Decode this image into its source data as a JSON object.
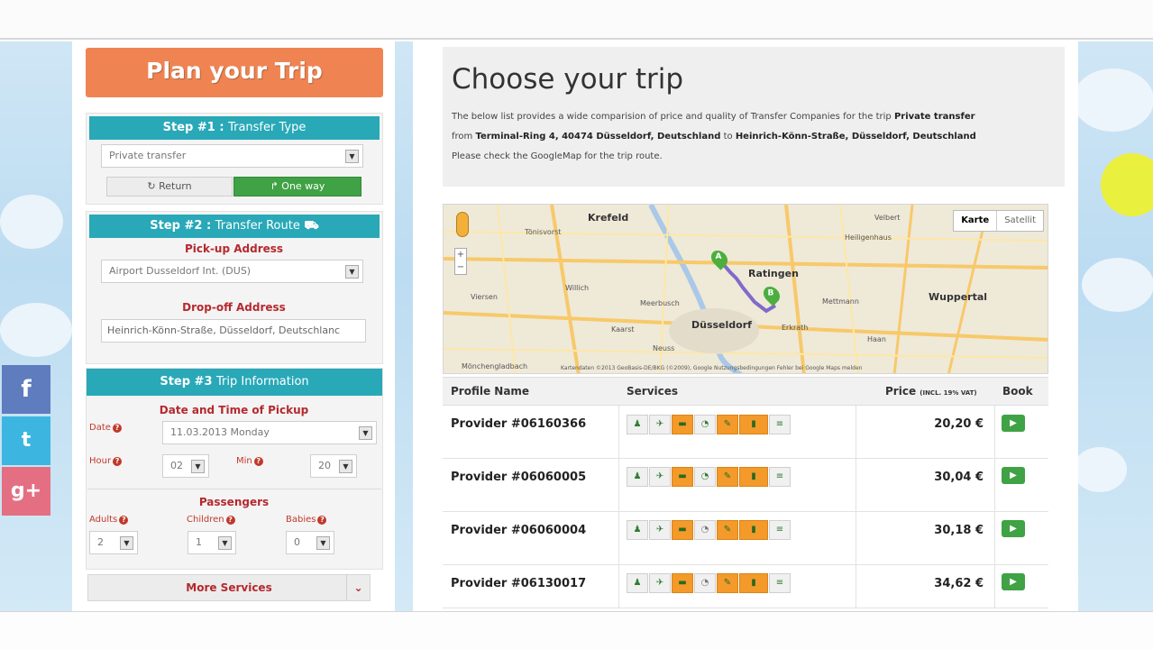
{
  "left": {
    "plan_title": "Plan your Trip",
    "step1": {
      "num": "Step #1 :",
      "title": "Transfer Type",
      "select_value": "Private transfer",
      "return_label": "Return",
      "oneway_label": "One way"
    },
    "step2": {
      "num": "Step #2 :",
      "title": "Transfer Route",
      "pickup_label": "Pick-up Address",
      "pickup_value": "Airport Dusseldorf Int. (DUS)",
      "dropoff_label": "Drop-off Address",
      "dropoff_value": "Heinrich-Könn-Straße, Düsseldorf, Deutschlanc"
    },
    "step3": {
      "num": "Step #3",
      "title": "Trip Information",
      "datetime_label": "Date and Time of Pickup",
      "date_label": "Date",
      "date_value": "11.03.2013 Monday",
      "hour_label": "Hour",
      "hour_value": "02",
      "min_label": "Min",
      "min_value": "20",
      "passengers_label": "Passengers",
      "adults_label": "Adults",
      "adults_value": "2",
      "children_label": "Children",
      "children_value": "1",
      "babies_label": "Babies",
      "babies_value": "0"
    },
    "more_services": "More Services"
  },
  "social": {
    "facebook": "f",
    "twitter": "t",
    "googleplus": "g+"
  },
  "main": {
    "heading": "Choose your trip",
    "desc_1": "The below list provides a wide comparision of price and quality of Transfer Companies for the trip",
    "desc_trip": "Private transfer",
    "desc_from": "from",
    "desc_from_addr": "Terminal-Ring 4, 40474 Düsseldorf, Deutschland",
    "desc_to": "to",
    "desc_to_addr": "Heinrich-Könn-Straße, Düsseldorf, Deutschland",
    "desc_2": "Please check the GoogleMap for the trip route."
  },
  "map": {
    "type_map": "Karte",
    "type_sat": "Satellit",
    "credit": "Kartendaten ©2013 GeoBasis-DE/BKG (©2009), Google",
    "terms": "Nutzungsbedingungen",
    "report": "Fehler bei Google Maps melden",
    "cities": {
      "krefeld": "Krefeld",
      "ratingen": "Ratingen",
      "wuppertal": "Wuppertal",
      "dusseldorf": "Düsseldorf",
      "viersen": "Viersen",
      "meerbusch": "Meerbusch",
      "neuss": "Neuss",
      "velbert": "Velbert",
      "tonisvorst": "Tönisvorst",
      "willich": "Willich",
      "mettmann": "Mettmann",
      "heiligenhaus": "Heiligenhaus",
      "haan": "Haan",
      "erkrath": "Erkrath",
      "kaarst": "Kaarst",
      "mönchengladbach": "Mönchengladbach"
    }
  },
  "table": {
    "col_profile": "Profile Name",
    "col_services": "Services",
    "col_price": "Price",
    "col_price_note": "(INCL. 19% VAT)",
    "col_book": "Book",
    "rows": [
      {
        "name": "Provider #06160366",
        "price": "20,20 €"
      },
      {
        "name": "Provider #06060005",
        "price": "30,04 €"
      },
      {
        "name": "Provider #06060004",
        "price": "30,18 €"
      },
      {
        "name": "Provider #06130017",
        "price": "34,62 €"
      }
    ]
  }
}
